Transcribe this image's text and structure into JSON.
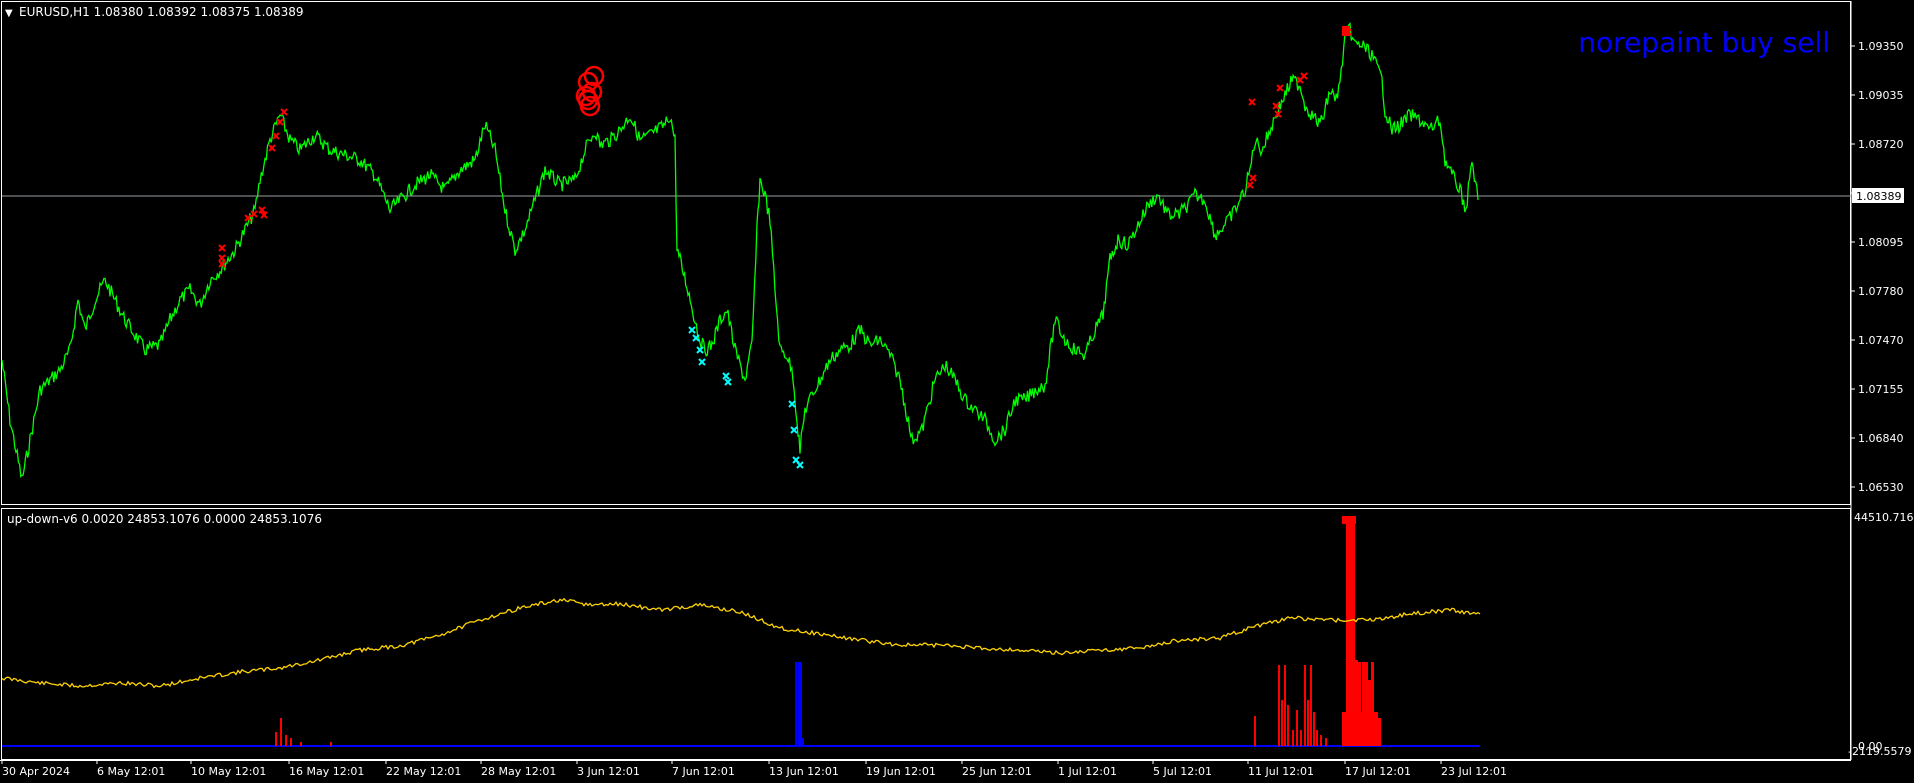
{
  "main_panel": {
    "header_arrow": "▼",
    "symbol_info": "EURUSD,H1  1.08380 1.08392 1.08375 1.08389",
    "watermark": "norepaint buy sell",
    "current_price": "1.08389",
    "price_ticks": [
      "1.09350",
      "1.09035",
      "1.08720",
      "1.08405",
      "1.08095",
      "1.07780",
      "1.07470",
      "1.07155",
      "1.06840",
      "1.06530"
    ]
  },
  "indicator_panel": {
    "info": "up-down-v6 0.0020 24853.1076 0.0000 24853.1076",
    "max_label": "44510.716",
    "zero_label": "0.00",
    "min_label": "-2119.5579"
  },
  "time_axis": [
    "30 Apr 2024",
    "6 May 12:01",
    "10 May 12:01",
    "16 May 12:01",
    "22 May 12:01",
    "28 May 12:01",
    "3 Jun 12:01",
    "7 Jun 12:01",
    "13 Jun 12:01",
    "19 Jun 12:01",
    "25 Jun 12:01",
    "1 Jul 12:01",
    "5 Jul 12:01",
    "11 Jul 12:01",
    "17 Jul 12:01",
    "23 Jul 12:01"
  ],
  "chart_data": {
    "type": "line",
    "price_series": {
      "x": [
        "30 Apr 2024",
        "6 May 12:01",
        "10 May 12:01",
        "16 May 12:01",
        "22 May 12:01",
        "28 May 12:01",
        "3 Jun 12:01",
        "7 Jun 12:01",
        "13 Jun 12:01",
        "19 Jun 12:01",
        "25 Jun 12:01",
        "1 Jul 12:01",
        "5 Jul 12:01",
        "11 Jul 12:01",
        "17 Jul 12:01",
        "23 Jul 12:01"
      ],
      "y": [
        1.0715,
        1.077,
        1.08,
        1.0875,
        1.085,
        1.084,
        1.088,
        1.081,
        1.069,
        1.074,
        1.071,
        1.076,
        1.0825,
        1.088,
        1.092,
        1.084
      ]
    },
    "indicator_line": {
      "x": [
        "30 Apr 2024",
        "6 May 12:01",
        "10 May 12:01",
        "16 May 12:01",
        "22 May 12:01",
        "28 May 12:01",
        "3 Jun 12:01",
        "7 Jun 12:01",
        "13 Jun 12:01",
        "19 Jun 12:01",
        "25 Jun 12:01",
        "1 Jul 12:01",
        "5 Jul 12:01",
        "11 Jul 12:01",
        "17 Jul 12:01",
        "23 Jul 12:01"
      ],
      "y": [
        11600,
        11300,
        13200,
        15700,
        19400,
        24000,
        26700,
        24800,
        20300,
        18800,
        17800,
        17500,
        19700,
        23500,
        25000,
        24853
      ]
    },
    "ylim_price": [
      1.064,
      1.096
    ],
    "ylim_indicator": [
      -2119.5579,
      44510.716
    ],
    "colors": {
      "price": "#00ff00",
      "indicator": "#ffd400",
      "hist_up": "#ff0000",
      "hist_down": "#0000ff",
      "buy_marker": "#00ffff",
      "sell_marker": "#ff0000"
    }
  }
}
